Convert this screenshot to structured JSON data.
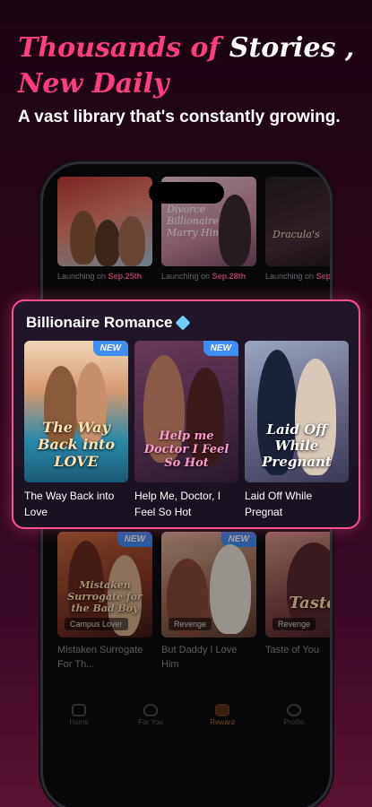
{
  "headline": {
    "line1_pink": "Thousands of",
    "line1_white": "Stories ,",
    "line2_pink": "New Daily"
  },
  "subline": "A vast library that's constantly growing.",
  "top_row": [
    {
      "prefix": "Launching on",
      "date": "Sep.25th",
      "cover_text": ""
    },
    {
      "prefix": "Launching on",
      "date": "Sep.28th",
      "cover_text": "Divorce Billionaire Marry Him!"
    },
    {
      "prefix": "Launching on",
      "date": "Sep.",
      "cover_text": "Dracula's"
    }
  ],
  "panel": {
    "title": "Billionaire Romance",
    "gem_icon": "diamond-icon",
    "books": [
      {
        "title": "The Way Back into Love",
        "badge": "NEW",
        "cover_text": "The Way Back into LOVE"
      },
      {
        "title": "Help Me, Doctor, I Feel So Hot",
        "badge": "NEW",
        "cover_text": "Help me Doctor I Feel So Hot"
      },
      {
        "title": "Laid Off While Pregnat",
        "badge": "",
        "cover_text": "Laid Off While Pregnant"
      }
    ]
  },
  "bottom_row": [
    {
      "title": "Mistaken Surrogate For Th...",
      "tag": "Campus Lover",
      "badge": "NEW",
      "cover_text": "Mistaken Surrogate for the Bad Boy"
    },
    {
      "title": "But Daddy I Love Him",
      "tag": "Revenge",
      "badge": "NEW",
      "cover_text": ""
    },
    {
      "title": "Taste of You",
      "tag": "Revenge",
      "badge": "",
      "cover_text": "Taste"
    }
  ],
  "tabs": [
    {
      "label": "Home",
      "icon": "home-icon"
    },
    {
      "label": "For You",
      "icon": "heart-icon"
    },
    {
      "label": "Reward",
      "icon": "gift-icon"
    },
    {
      "label": "Profile",
      "icon": "profile-icon"
    }
  ],
  "colors": {
    "accent_pink": "#ff3d7f",
    "badge_blue": "#3f8cf3",
    "launch_date": "#ff5b8e"
  }
}
